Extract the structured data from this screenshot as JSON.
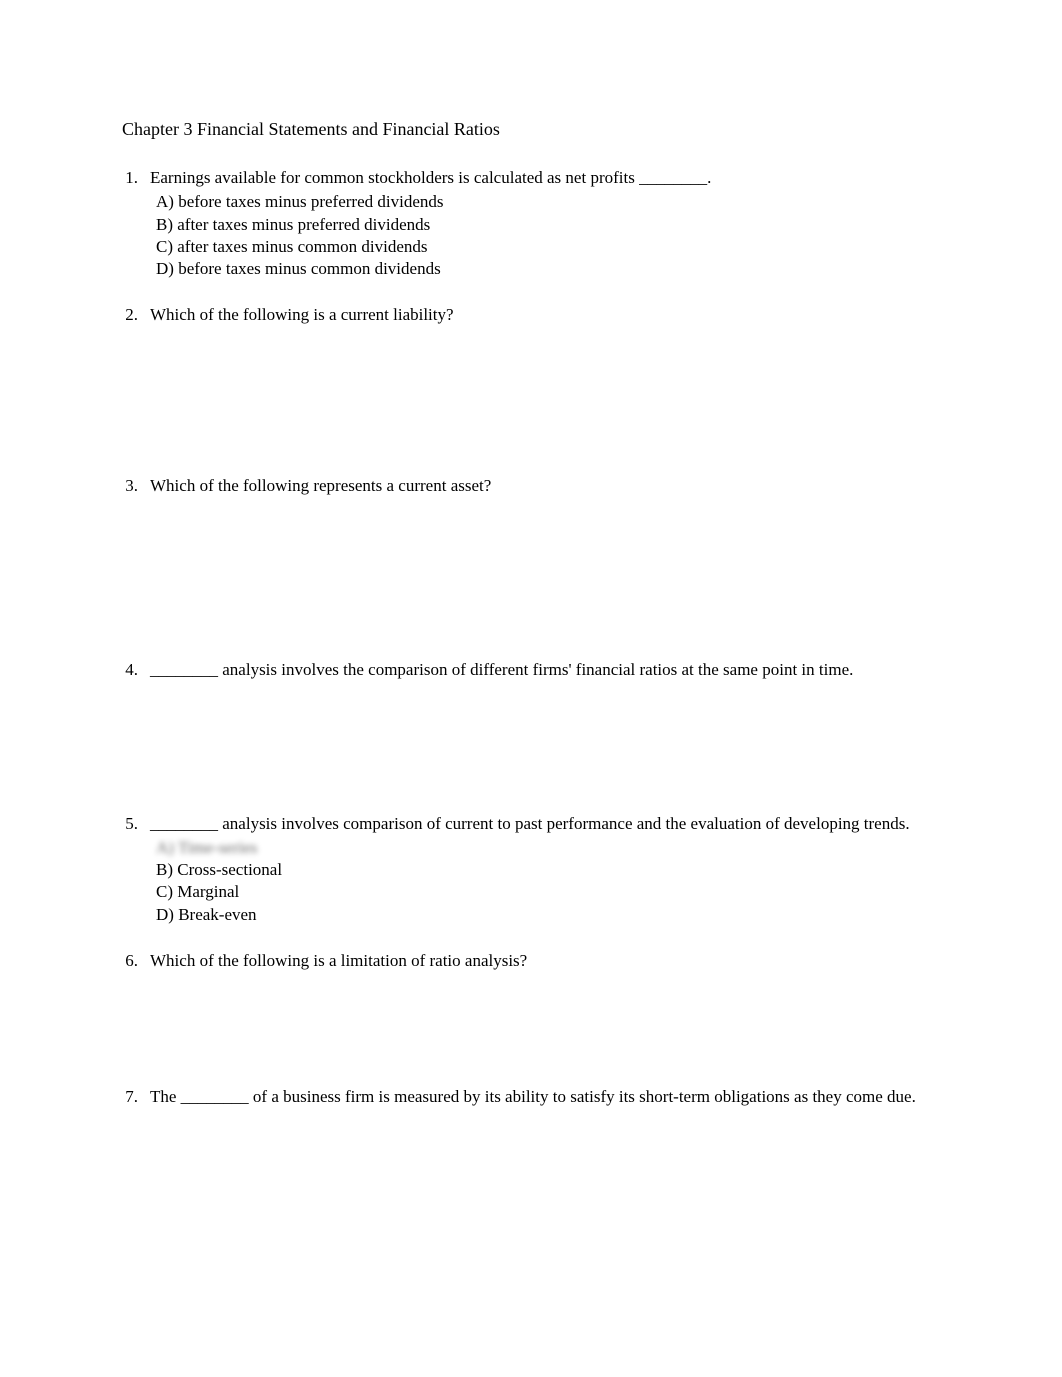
{
  "chapter_title": "Chapter 3 Financial Statements and Financial Ratios",
  "questions": [
    {
      "number": "1.",
      "text": "Earnings available for common stockholders is calculated as net profits ________.",
      "options": [
        "A) before taxes minus preferred dividends",
        "B) after taxes minus preferred dividends",
        "C) after taxes minus common dividends",
        "D) before taxes minus common dividends"
      ]
    },
    {
      "number": "2.",
      "text": "Which of the following is a current liability?",
      "options": []
    },
    {
      "number": "3.",
      "text": "Which of the following represents a current asset?",
      "options": []
    },
    {
      "number": "4.",
      "text": "________ analysis involves the comparison of different firms' financial ratios at the same point in time.",
      "options": []
    },
    {
      "number": "5.",
      "text": "________ analysis involves comparison of current to past performance and the evaluation of developing trends.",
      "options": [
        "A) Time-series",
        "B) Cross-sectional",
        "C) Marginal",
        "D) Break-even"
      ]
    },
    {
      "number": "6.",
      "text": "Which of the following is a limitation of ratio analysis?",
      "options": []
    },
    {
      "number": "7.",
      "text": "The ________ of a business firm is measured by its ability to satisfy its short-term obligations as they come due.",
      "options": []
    }
  ]
}
